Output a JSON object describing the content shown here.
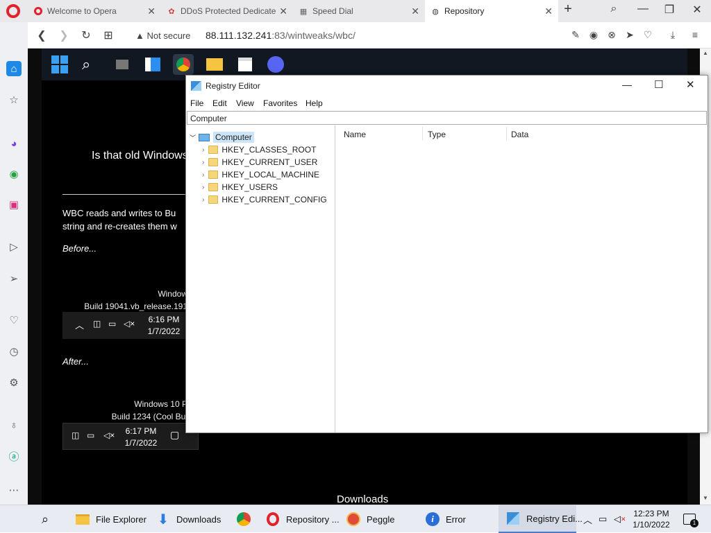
{
  "browser": {
    "tabs": [
      {
        "title": "Welcome to Opera",
        "icon": "opera-icon"
      },
      {
        "title": "DDoS Protected Dedicate",
        "icon": "flower-icon"
      },
      {
        "title": "Speed Dial",
        "icon": "grid-icon"
      },
      {
        "title": "Repository",
        "icon": "globe-icon",
        "active": true
      }
    ],
    "not_secure": "Not secure",
    "url_host": "88.111.132.241",
    "url_rest": ":83/wintweaks/wbc/"
  },
  "page": {
    "heading_partial": "Is that old Windows",
    "para1": "WBC reads and writes to Bu",
    "para2": "string and re-creates them w",
    "before": "Before...",
    "after": "After...",
    "before_img": {
      "line1": "Window",
      "line2": "Build 19041.vb_release.191",
      "time": "6:16 PM",
      "date": "1/7/2022"
    },
    "after_img": {
      "line1": "Windows 10 P",
      "line2": "Build 1234 (Cool Bui",
      "time": "6:17 PM",
      "date": "1/7/2022"
    },
    "downloads": "Downloads"
  },
  "regedit": {
    "title": "Registry Editor",
    "menu": [
      "File",
      "Edit",
      "View",
      "Favorites",
      "Help"
    ],
    "address": "Computer",
    "tree_root": "Computer",
    "hives": [
      "HKEY_CLASSES_ROOT",
      "HKEY_CURRENT_USER",
      "HKEY_LOCAL_MACHINE",
      "HKEY_USERS",
      "HKEY_CURRENT_CONFIG"
    ],
    "columns": [
      "Name",
      "Type",
      "Data"
    ]
  },
  "taskbar": {
    "items": [
      {
        "label": "File Explorer"
      },
      {
        "label": "Downloads"
      },
      {
        "label": ""
      },
      {
        "label": "Repository ..."
      },
      {
        "label": "Peggle"
      },
      {
        "label": "Error"
      },
      {
        "label": "Registry Edi..."
      }
    ],
    "time": "12:23 PM",
    "date": "1/10/2022",
    "notif_count": "1"
  }
}
